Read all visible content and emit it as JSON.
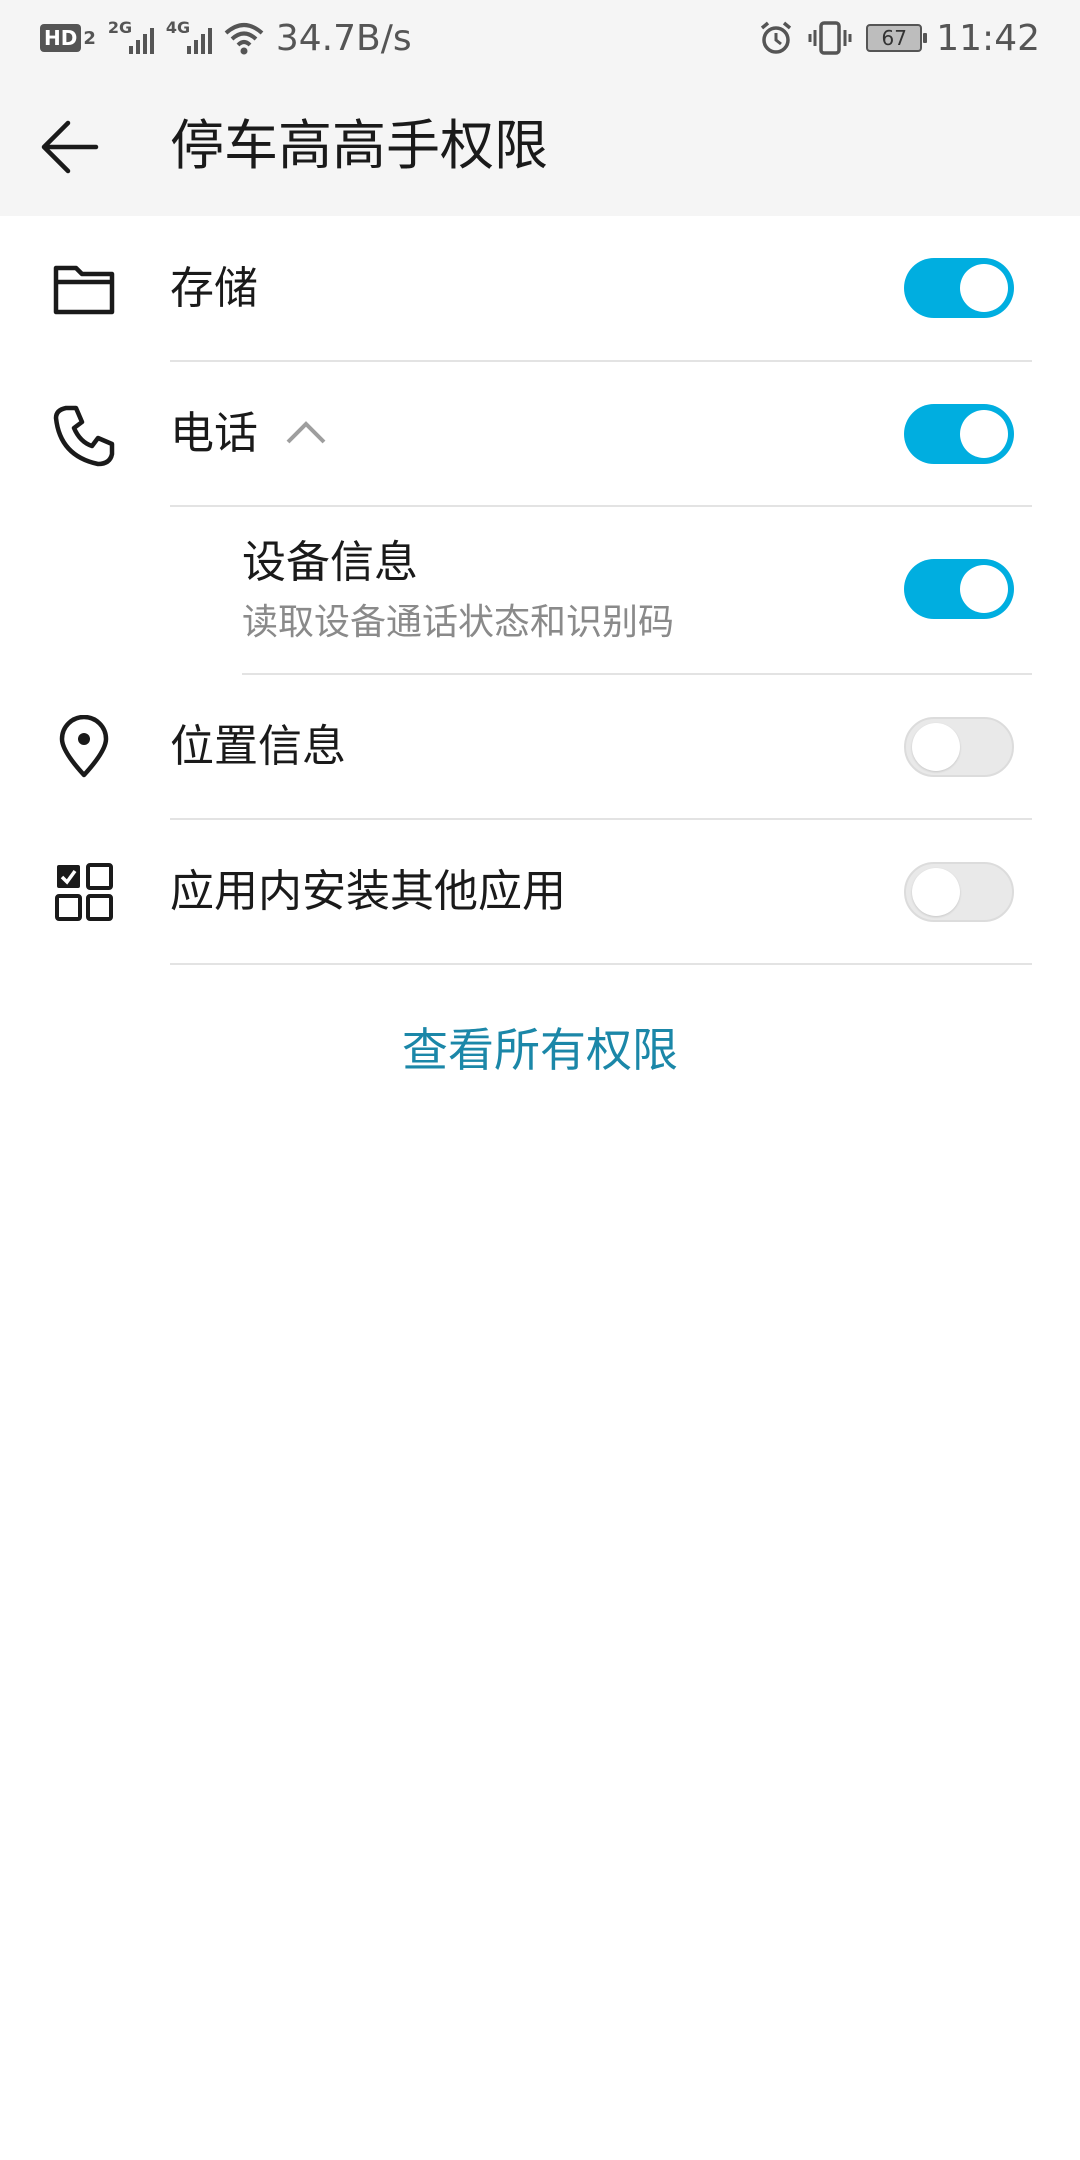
{
  "status_bar": {
    "hd_label": "HD",
    "hd_sub": "2",
    "sim1_tag": "2G",
    "sim2_tag": "4G",
    "net_speed": "34.7B/s",
    "battery_level": "67",
    "time": "11:42"
  },
  "header": {
    "title": "停车高高手权限"
  },
  "permissions": [
    {
      "label": "存储",
      "icon": "folder-icon",
      "enabled": true
    },
    {
      "label": "电话",
      "icon": "phone-icon",
      "enabled": true,
      "expanded": true,
      "children": [
        {
          "title": "设备信息",
          "description": "读取设备通话状态和识别码",
          "enabled": true
        }
      ]
    },
    {
      "label": "位置信息",
      "icon": "location-pin-icon",
      "enabled": false
    },
    {
      "label": "应用内安装其他应用",
      "icon": "apps-grid-icon",
      "enabled": false
    }
  ],
  "footer": {
    "view_all_label": "查看所有权限"
  },
  "colors": {
    "switch_on": "#00aee0",
    "switch_off": "#e9e9e9",
    "link": "#1b87a8",
    "bar_background": "#f5f5f5"
  }
}
